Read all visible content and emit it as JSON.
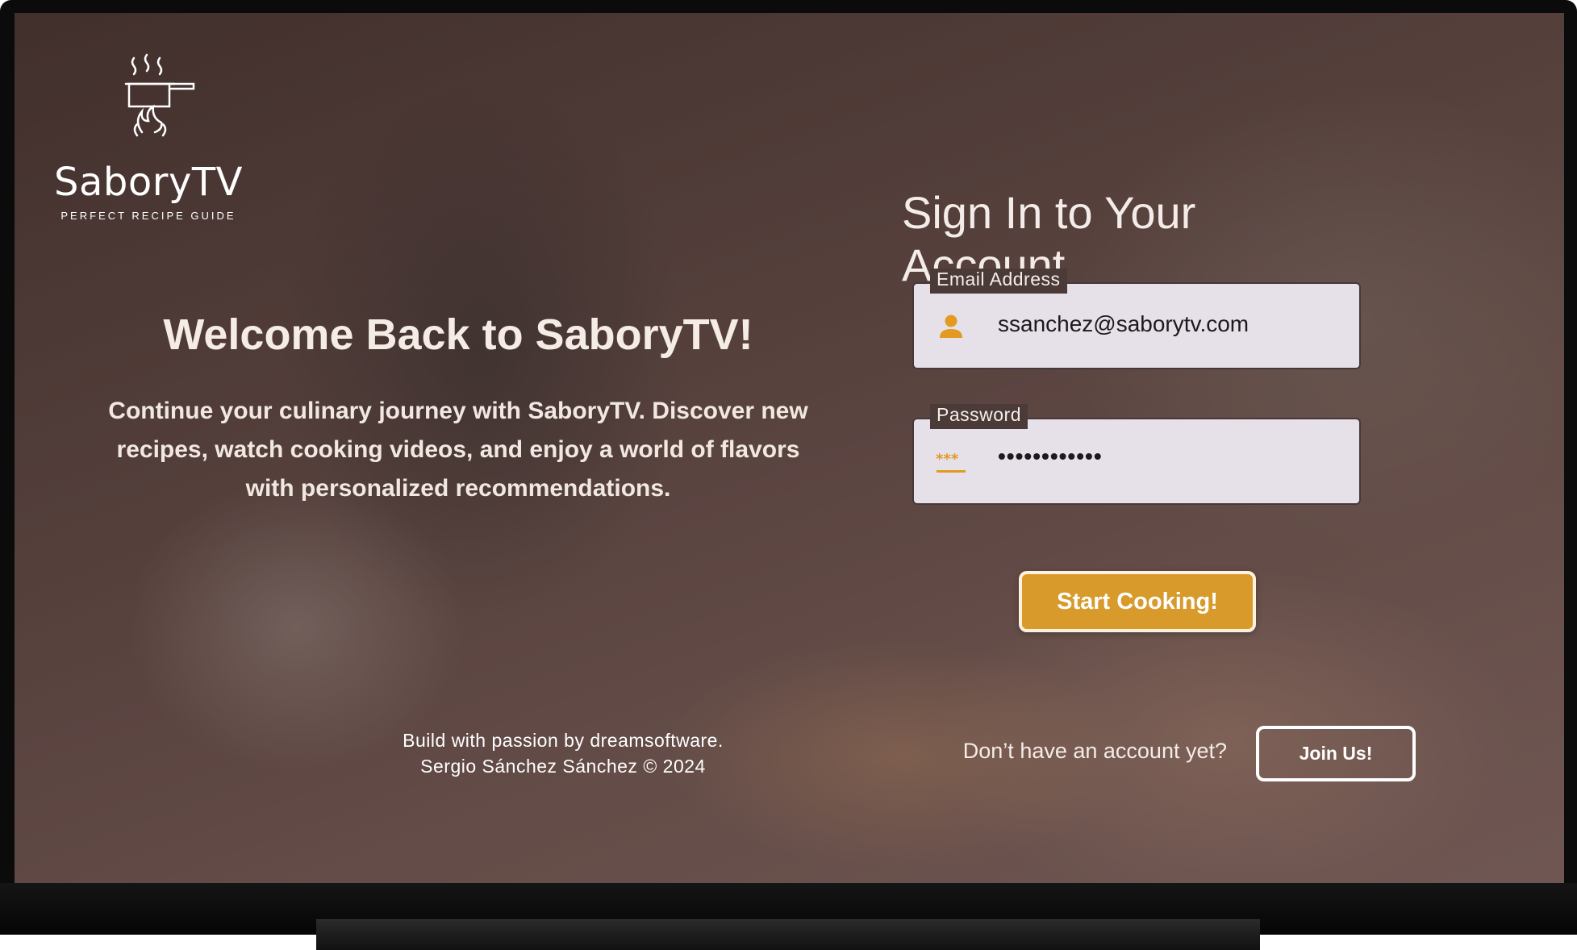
{
  "brand": {
    "name": "SaboryTV",
    "tagline": "PERFECT RECIPE GUIDE",
    "logo_icon": "cooking-pot-flame-icon"
  },
  "welcome": {
    "title": "Welcome Back to SaboryTV!",
    "description": "Continue your culinary journey with SaboryTV. Discover new recipes, watch cooking videos, and enjoy a world of flavors with personalized recommendations."
  },
  "credits": {
    "line1": "Build with passion by dreamsoftware.",
    "line2": "Sergio Sánchez Sánchez © 2024"
  },
  "signin": {
    "title": "Sign In to Your Account",
    "email": {
      "label": "Email Address",
      "value": "ssanchez@saborytv.com",
      "icon": "person-icon"
    },
    "password": {
      "label": "Password",
      "value": "••••••••••••",
      "icon": "password-dots-icon"
    },
    "submit_label": "Start Cooking!",
    "signup_prompt": "Don’t have an account yet?",
    "signup_label": "Join Us!"
  },
  "colors": {
    "accent": "#d89a2a",
    "field_bg": "#e6e0e8",
    "text_light": "#f4ece8"
  }
}
